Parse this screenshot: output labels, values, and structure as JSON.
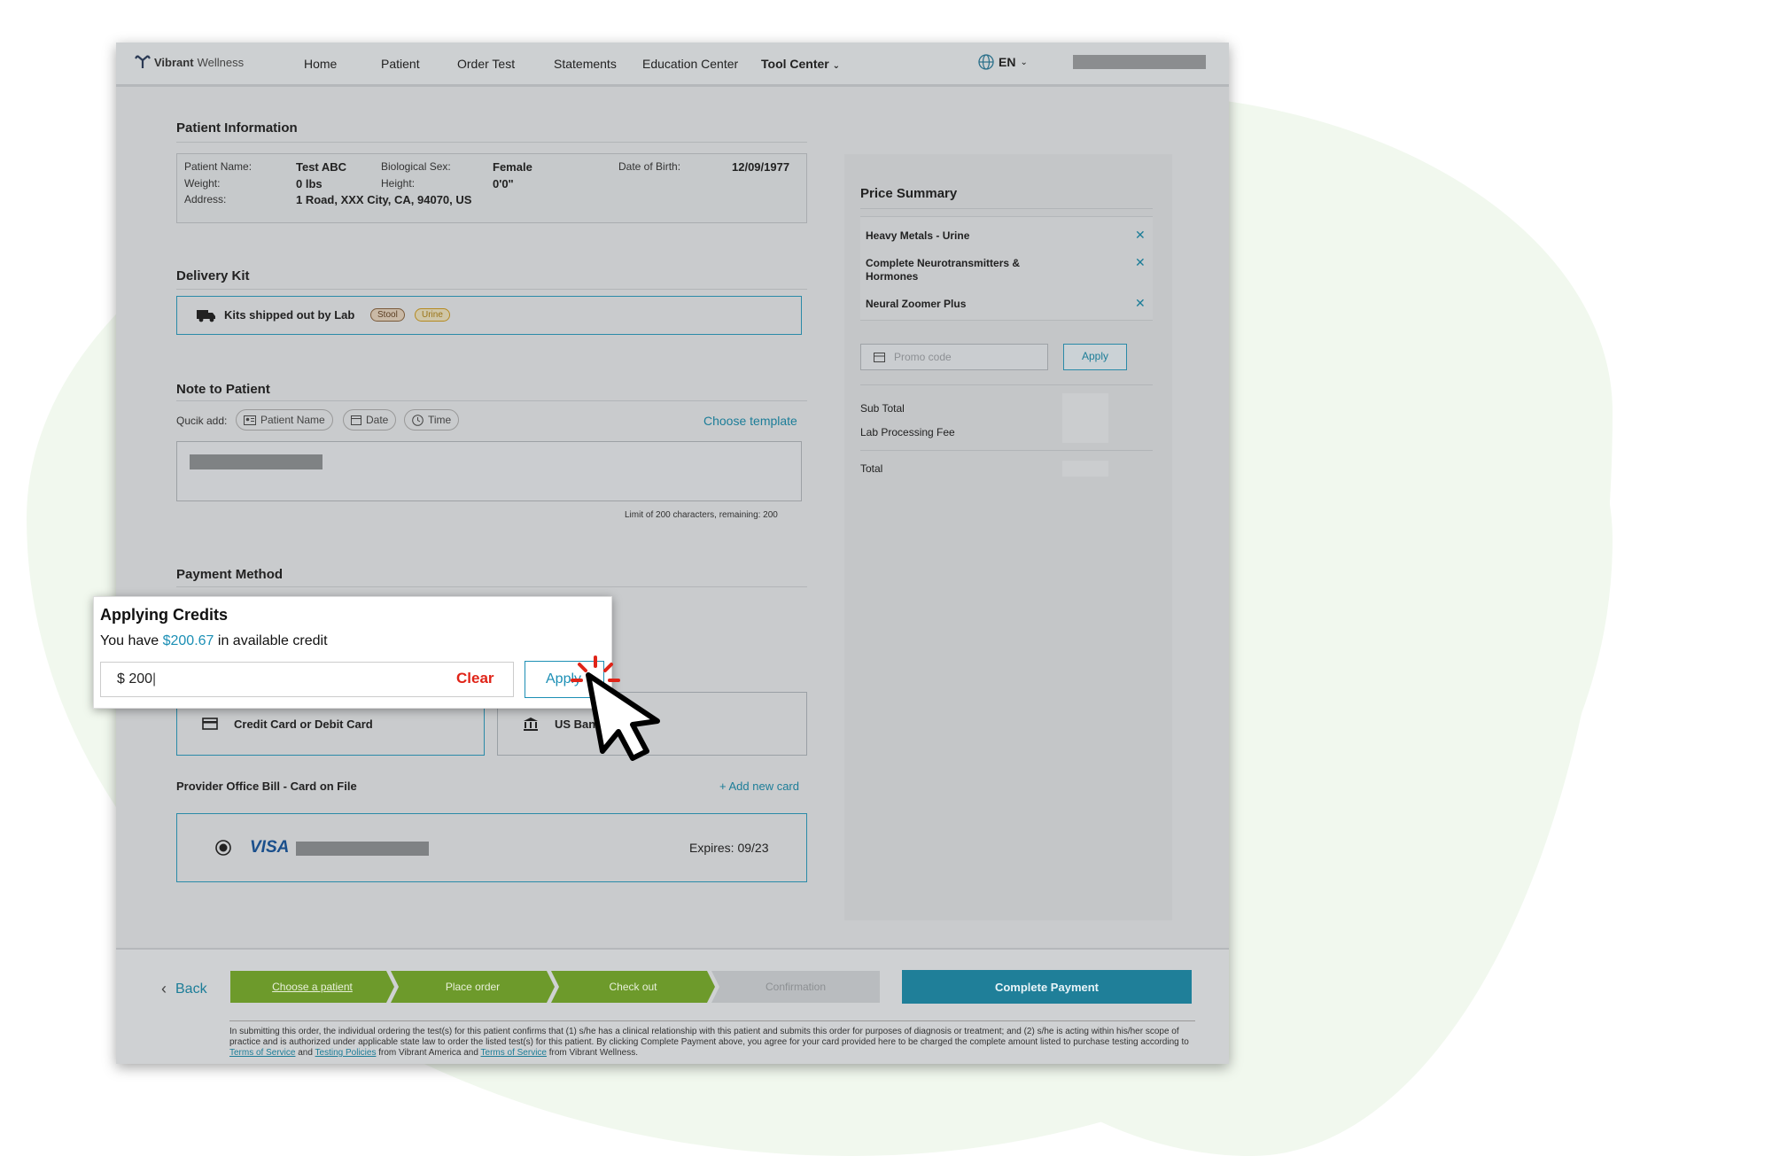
{
  "header": {
    "logo_brand": "Vibrant",
    "logo_suffix": "Wellness",
    "nav": [
      "Home",
      "Patient",
      "Order Test",
      "Statements",
      "Education Center",
      "Tool Center"
    ],
    "language": "EN"
  },
  "patient_info": {
    "title": "Patient Information",
    "name_label": "Patient Name:",
    "name": "Test ABC",
    "sex_label": "Biological Sex:",
    "sex": "Female",
    "dob_label": "Date of Birth:",
    "dob": "12/09/1977",
    "weight_label": "Weight:",
    "weight": "0 lbs",
    "height_label": "Height:",
    "height": "0'0\"",
    "address_label": "Address:",
    "address": "1 Road, XXX City, CA, 94070, US"
  },
  "delivery": {
    "title": "Delivery Kit",
    "label": "Kits shipped out by Lab",
    "chip_stool": "Stool",
    "chip_urine": "Urine"
  },
  "note": {
    "title": "Note to Patient",
    "quick_add_label": "Qucik add:",
    "chips": [
      "Patient Name",
      "Date",
      "Time"
    ],
    "choose_template": "Choose template",
    "limit_text": "Limit of 200 characters, remaining: 200"
  },
  "payment": {
    "title": "Payment Method",
    "credit_card": "Credit Card or Debit Card",
    "us_bank": "US Bank",
    "provider_bill": "Provider Office Bill - Card on File",
    "add_card": "+ Add new card",
    "visa_label": "VISA",
    "expires": "Expires: 09/23"
  },
  "price_summary": {
    "title": "Price Summary",
    "items": [
      "Heavy Metals - Urine",
      "Complete Neurotransmitters & Hormones",
      "Neural Zoomer Plus"
    ],
    "promo_placeholder": "Promo code",
    "apply": "Apply",
    "sub_total": "Sub Total",
    "lab_fee": "Lab Processing Fee",
    "total": "Total"
  },
  "footer": {
    "back": "Back",
    "steps": [
      "Choose a patient",
      "Place order",
      "Check out",
      "Confirmation"
    ],
    "complete_payment": "Complete Payment",
    "disclaimer_main": "In submitting this order, the individual ordering the test(s) for this patient confirms that (1) s/he has a clinical relationship with this patient and submits this order for purposes of diagnosis or treatment; and (2) s/he is acting within his/her scope of practice and is authorized under applicable state law to order the listed test(s) for this patient. By clicking Complete Payment above, you agree for your card provided here to be charged the complete amount listed to purchase testing according to",
    "terms_of_service": "Terms of Service",
    "and": "and",
    "testing_policies": "Testing Policies",
    "from_vibrant_america": "from Vibrant America and",
    "terms_of_service_2": "Terms of Service",
    "from_vibrant_wellness": "from Vibrant Wellness."
  },
  "credits_popup": {
    "title": "Applying Credits",
    "prefix": "You have",
    "amount": "$200.67",
    "suffix": "in available credit",
    "input_value": "$ 200",
    "clear": "Clear",
    "apply": "Apply"
  },
  "colors": {
    "accent": "#1c7d98",
    "step_active": "#6d9a2b",
    "clear_red": "#e02418",
    "background_blob": "#f1f8ee"
  }
}
